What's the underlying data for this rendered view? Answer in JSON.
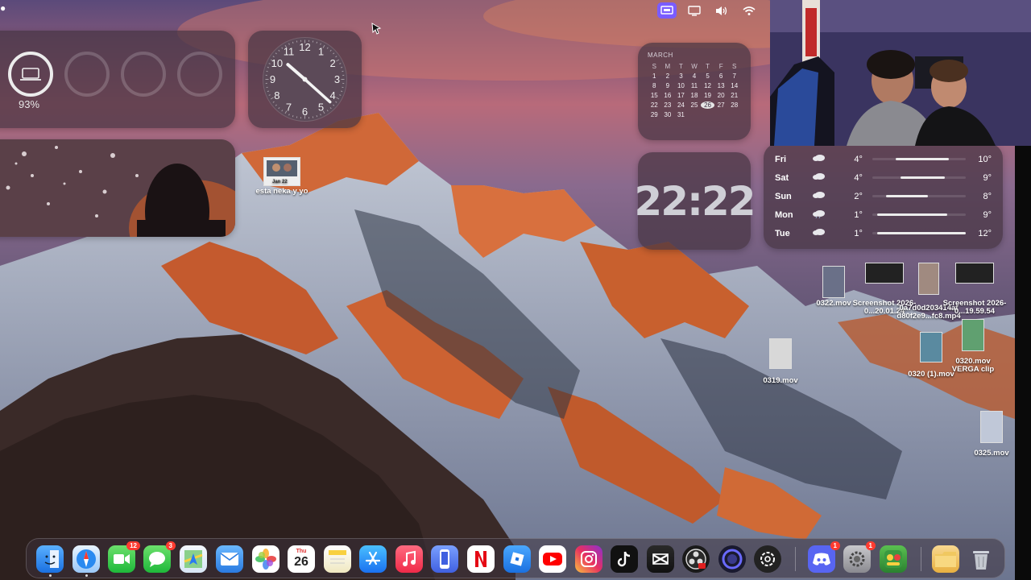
{
  "menubar": {
    "status_icons": [
      "screen-mirroring-icon",
      "display-icon",
      "volume-icon",
      "wifi-icon"
    ]
  },
  "widgets": {
    "battery": {
      "percent_label": "93%",
      "level": 0.93
    },
    "clock": {
      "hour": 10,
      "minute": 22,
      "numbers": [
        "12",
        "1",
        "2",
        "3",
        "4",
        "5",
        "6",
        "7",
        "8",
        "9",
        "10",
        "11"
      ]
    },
    "calendar": {
      "month": "MARCH",
      "weekdays": [
        "S",
        "M",
        "T",
        "W",
        "T",
        "F",
        "S"
      ],
      "weeks": [
        [
          "1",
          "2",
          "3",
          "4",
          "5",
          "6",
          "7"
        ],
        [
          "8",
          "9",
          "10",
          "11",
          "12",
          "13",
          "14"
        ],
        [
          "15",
          "16",
          "17",
          "18",
          "19",
          "20",
          "21"
        ],
        [
          "22",
          "23",
          "24",
          "25",
          "26",
          "27",
          "28"
        ],
        [
          "29",
          "30",
          "31",
          "",
          "",
          "",
          ""
        ]
      ],
      "today": "26"
    },
    "digital_clock": {
      "time": "22:22"
    },
    "weather": {
      "days": [
        {
          "day": "Fri",
          "icon": "cloud-icon",
          "lo": "4°",
          "hi": "10°",
          "bar_start": 0.25,
          "bar_end": 0.82
        },
        {
          "day": "Sat",
          "icon": "cloud-icon",
          "lo": "4°",
          "hi": "9°",
          "bar_start": 0.3,
          "bar_end": 0.78
        },
        {
          "day": "Sun",
          "icon": "cloud-icon",
          "lo": "2°",
          "hi": "8°",
          "bar_start": 0.15,
          "bar_end": 0.6
        },
        {
          "day": "Mon",
          "icon": "cloud-rain-icon",
          "lo": "1°",
          "hi": "9°",
          "bar_start": 0.05,
          "bar_end": 0.8
        },
        {
          "day": "Tue",
          "icon": "cloud-icon",
          "lo": "1°",
          "hi": "12°",
          "bar_start": 0.05,
          "bar_end": 1.0
        }
      ]
    }
  },
  "desktop_icons": [
    {
      "name": "esta neka y yo"
    },
    {
      "name": "0322.mov"
    },
    {
      "name": "Screenshot 2026-0...20.01.24"
    },
    {
      "name": "0a7d0d203414af d80f2e9...fc8.mp4"
    },
    {
      "name": "Screenshot 2026-0...19.59.54"
    },
    {
      "name": "0319.mov"
    },
    {
      "name": "0320 (1).mov"
    },
    {
      "name": "0320.mov VERGA clip"
    },
    {
      "name": "0325.mov"
    }
  ],
  "dock": {
    "calendar_day": "Thu",
    "calendar_date": "26",
    "badges": {
      "facetime": "12",
      "messages": "3",
      "discord": "1",
      "settings": "1"
    }
  }
}
